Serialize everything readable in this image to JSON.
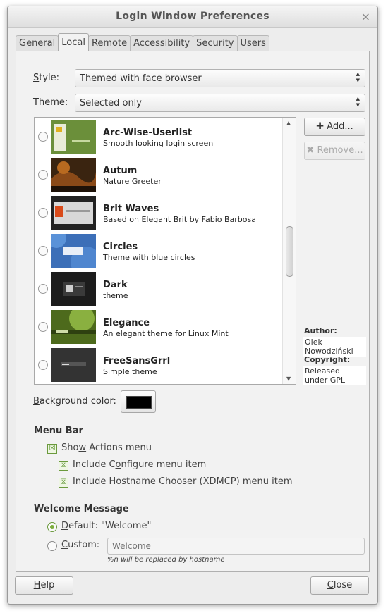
{
  "window": {
    "title": "Login Window Preferences",
    "close_glyph": "×"
  },
  "tabs": [
    {
      "label": "General"
    },
    {
      "label": "Local"
    },
    {
      "label": "Remote"
    },
    {
      "label": "Accessibility"
    },
    {
      "label": "Security"
    },
    {
      "label": "Users"
    }
  ],
  "style": {
    "label_u": "S",
    "label_rest": "tyle:",
    "value": "Themed with face browser"
  },
  "theme": {
    "label_u": "T",
    "label_rest": "heme:",
    "value": "Selected only"
  },
  "themes": [
    {
      "name": "Arc-Wise-Userlist",
      "desc": "Smooth looking login screen"
    },
    {
      "name": "Autum",
      "desc": "Nature Greeter"
    },
    {
      "name": "Brit Waves",
      "desc": "Based on Elegant Brit by Fabio Barbosa"
    },
    {
      "name": "Circles",
      "desc": "Theme with blue circles"
    },
    {
      "name": "Dark",
      "desc": "theme"
    },
    {
      "name": "Elegance",
      "desc": "An elegant theme for Linux Mint"
    },
    {
      "name": "FreeSansGrrl",
      "desc": "Simple theme"
    }
  ],
  "buttons": {
    "add": {
      "icon": "✚",
      "label_u": "A",
      "label_rest": "dd..."
    },
    "remove": {
      "icon": "✖",
      "label": "Remove..."
    },
    "help": {
      "label_u": "H",
      "label_rest": "elp"
    },
    "close": {
      "label_u": "C",
      "label_rest": "lose"
    }
  },
  "info": {
    "author_label": "Author:",
    "author_value": "Olek Nowodziński",
    "copyright_label": "Copyright:",
    "copyright_value": "Released under GPL"
  },
  "background_color": {
    "label_u": "B",
    "label_rest": "ackground color:",
    "value": "#000000"
  },
  "menu_bar": {
    "title": "Menu Bar",
    "show_actions": {
      "pre": "Sho",
      "u": "w",
      "post": " Actions menu",
      "checked": true
    },
    "include_configure": {
      "pre": "Include C",
      "u": "o",
      "post": "nfigure menu item",
      "checked": true
    },
    "include_hostname": {
      "pre": "Includ",
      "u": "e",
      "post": " Hostname Chooser (XDMCP) menu item",
      "checked": true
    }
  },
  "welcome": {
    "title": "Welcome Message",
    "default": {
      "u": "D",
      "rest": "efault: \"Welcome\"",
      "selected": true
    },
    "custom": {
      "u": "C",
      "rest": "ustom:",
      "selected": false,
      "placeholder": "Welcome"
    },
    "hint": "%n will be replaced by hostname"
  },
  "check_glyph": "☒"
}
